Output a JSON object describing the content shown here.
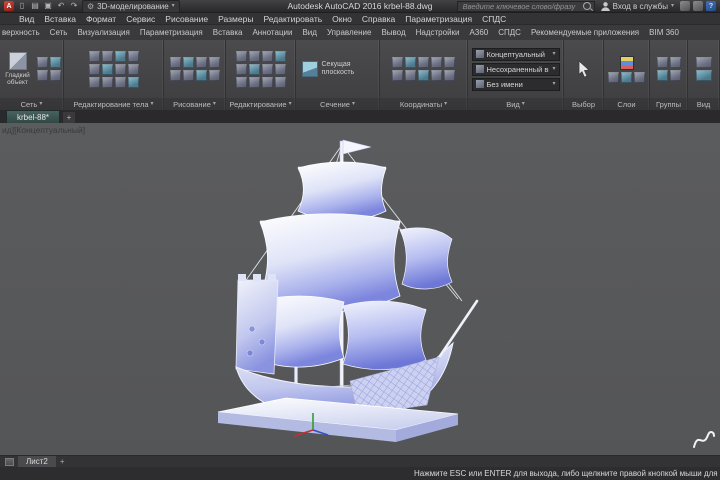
{
  "colors": {
    "titlebar_bg": "#2a2a2c",
    "ribbon_bg": "#434345",
    "viewport_bg": "#57585a",
    "file_tab_teal": "#3d5b59",
    "sail_blue": "#7d86dd",
    "ucs_x_red": "#c92f2c",
    "ucs_y_green": "#2f9e30"
  },
  "icons": {
    "logo": "A",
    "caret": "▾",
    "gear": "⚙",
    "plus": "+",
    "help": "?",
    "new": "▯",
    "open": "▤",
    "save": "▣",
    "undo": "↶",
    "redo": "↷"
  },
  "titlebar": {
    "workspace": "3D-моделирование",
    "title": "Autodesk AutoCAD 2016   krbel-88.dwg",
    "search_placeholder": "Введите ключевое слово/фразу",
    "signin": "Вход в службы"
  },
  "menubar": {
    "items": [
      "Вид",
      "Вставка",
      "Формат",
      "Сервис",
      "Рисование",
      "Размеры",
      "Редактировать",
      "Окно",
      "Справка",
      "Параметризация",
      "СПДС"
    ]
  },
  "ribbon_tabs": {
    "items": [
      "верхность",
      "Сеть",
      "Визуализация",
      "Параметризация",
      "Вставка",
      "Аннотации",
      "Вид",
      "Управление",
      "Вывод",
      "Надстройки",
      "A360",
      "СПДС",
      "Рекомендуемые приложения",
      "BIM 360"
    ]
  },
  "ribbon": {
    "panels": [
      {
        "label": "Сеть",
        "big_button": "Гладкий объект"
      },
      {
        "label": "Редактирование тела"
      },
      {
        "label": "Рисование"
      },
      {
        "label": "Редактирование"
      },
      {
        "label": "Сечение",
        "big_button": "Секущая плоскость"
      },
      {
        "label": "Координаты"
      },
      {
        "label": "Вид",
        "combos": [
          "Концептуальный",
          "Несохраненный вид",
          "Без имени"
        ]
      },
      {
        "label": "Выбор"
      },
      {
        "label": "Слои"
      },
      {
        "label": "Группы"
      },
      {
        "label": "Вид"
      }
    ]
  },
  "filetabs": {
    "tab": "krbel-88*"
  },
  "viewport": {
    "label": "ид][Концептуальный]"
  },
  "layoutbar": {
    "tab": "Лист2"
  },
  "statusbar": {
    "prompt": "Нажмите ESC или ENTER для выхода, либо щелкните правой кнопкой мыши для вы"
  }
}
